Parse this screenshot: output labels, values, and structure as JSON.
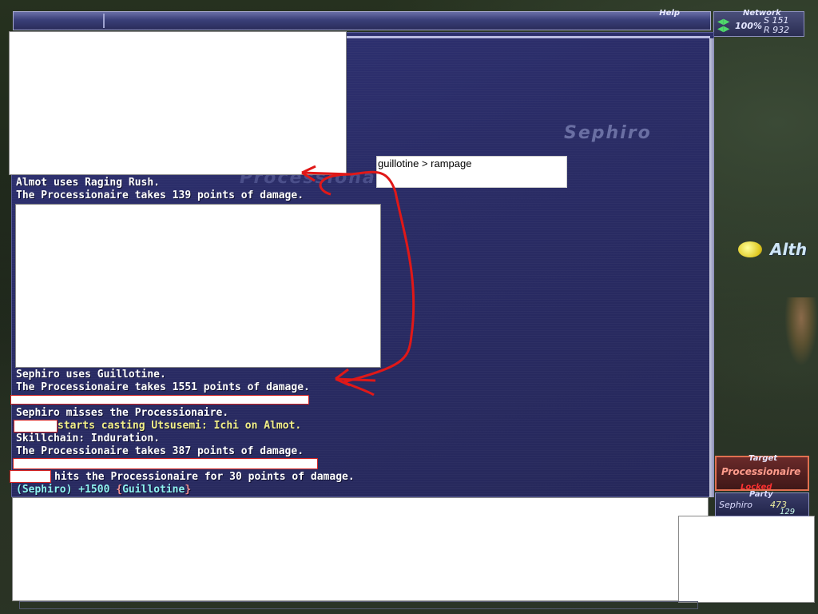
{
  "topbar": {
    "help_label": "Help"
  },
  "network": {
    "label": "Network",
    "percent": "100%",
    "send": "S 151",
    "receive": "R 932"
  },
  "background_names": {
    "primary": "Sephiro",
    "secondary": "Processionaire"
  },
  "annotation_note": "guillotine > rampage",
  "log": {
    "l1": "Almot uses Raging Rush.",
    "l2": "The Processionaire takes 139 points of damage.",
    "l3": "Sephiro uses Guillotine.",
    "l4": "The Processionaire takes 1551 points of damage.",
    "l5": "Sephiro misses the Processionaire.",
    "l6": "starts casting Utsusemi: Ichi on Almot.",
    "l7": "Skillchain: Induration.",
    "l8": "The Processionaire takes 387 points of damage.",
    "l9": "hits the Processionaire for 30 points of damage.",
    "l10_name": "(Sephiro) +1500 ",
    "l10_ws_open": "{",
    "l10_ws": "Guillotine",
    "l10_ws_close": "}"
  },
  "nameplate": {
    "name": "Alth"
  },
  "target": {
    "label": "Target",
    "name": "Processionaire",
    "status": "Locked"
  },
  "party": {
    "label": "Party",
    "member": "Sephiro",
    "hp": "473",
    "mp": "129"
  },
  "colors": {
    "annotation_arrow": "#e01818",
    "log_bg": "#2a2c66",
    "target_border": "#e07050"
  }
}
